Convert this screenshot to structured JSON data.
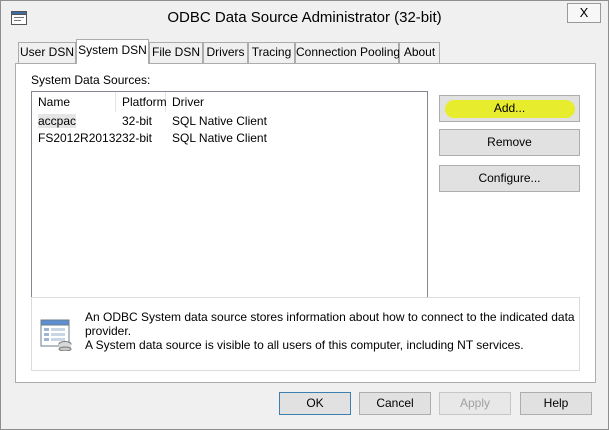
{
  "window": {
    "title": "ODBC Data Source Administrator (32-bit)",
    "close_glyph": "X",
    "app_icon": "odbc-app-icon"
  },
  "tabs": [
    {
      "label": "User DSN",
      "active": false
    },
    {
      "label": "System DSN",
      "active": true
    },
    {
      "label": "File DSN",
      "active": false
    },
    {
      "label": "Drivers",
      "active": false
    },
    {
      "label": "Tracing",
      "active": false
    },
    {
      "label": "Connection Pooling",
      "active": false
    },
    {
      "label": "About",
      "active": false
    }
  ],
  "panel": {
    "section_label": "System Data Sources:",
    "columns": [
      "Name",
      "Platform",
      "Driver"
    ],
    "rows": [
      {
        "name": "accpac",
        "platform": "32-bit",
        "driver": "SQL Native Client",
        "selected": true
      },
      {
        "name": "FS2012R20132",
        "platform": "32-bit",
        "driver": "SQL Native Client",
        "selected": false
      }
    ],
    "buttons": {
      "add": "Add...",
      "remove": "Remove",
      "configure": "Configure..."
    },
    "info": {
      "icon": "data-source-icon",
      "line1": "An ODBC System data source stores information about how to connect to the indicated data provider.",
      "line2": "A System data source is visible to all users of this computer, including NT services."
    },
    "highlight_color": "#e8ee18"
  },
  "footer": {
    "ok": "OK",
    "cancel": "Cancel",
    "apply": "Apply",
    "help": "Help"
  }
}
